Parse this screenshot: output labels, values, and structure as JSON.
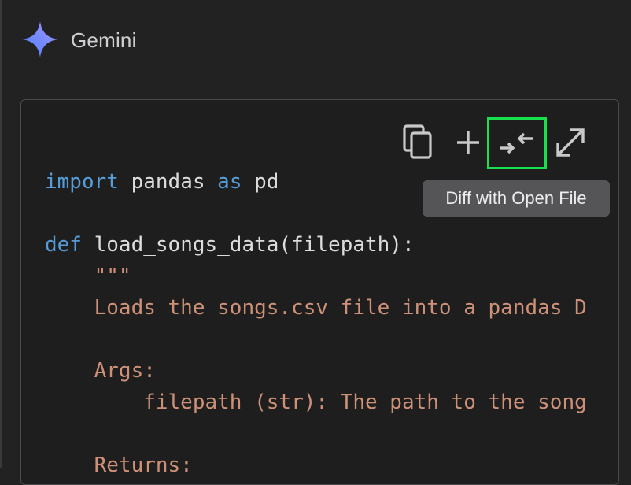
{
  "header": {
    "app_title": "Gemini"
  },
  "toolbar": {
    "copy_icon": "copy-icon",
    "insert_icon": "plus-icon",
    "diff_icon": "diff-arrows-icon",
    "expand_icon": "expand-icon",
    "tooltip": "Diff with Open File"
  },
  "colors": {
    "background": "#222223",
    "card": "#1e1e1f",
    "keyword": "#569cd6",
    "string": "#ce9178",
    "highlight": "#19e04d",
    "tooltip_bg": "#555558"
  },
  "code": {
    "l1": {
      "kw1": "import",
      "t1": " pandas ",
      "kw2": "as",
      "t2": " pd"
    },
    "l2": "",
    "l3": {
      "kw": "def",
      "t": " load_songs_data(filepath):"
    },
    "l4": "    \"\"\"",
    "l5": "    Loads the songs.csv file into a pandas D",
    "l6": "",
    "l7": "    Args:",
    "l8": "        filepath (str): The path to the song",
    "l9": "",
    "l10": "    Returns:"
  }
}
